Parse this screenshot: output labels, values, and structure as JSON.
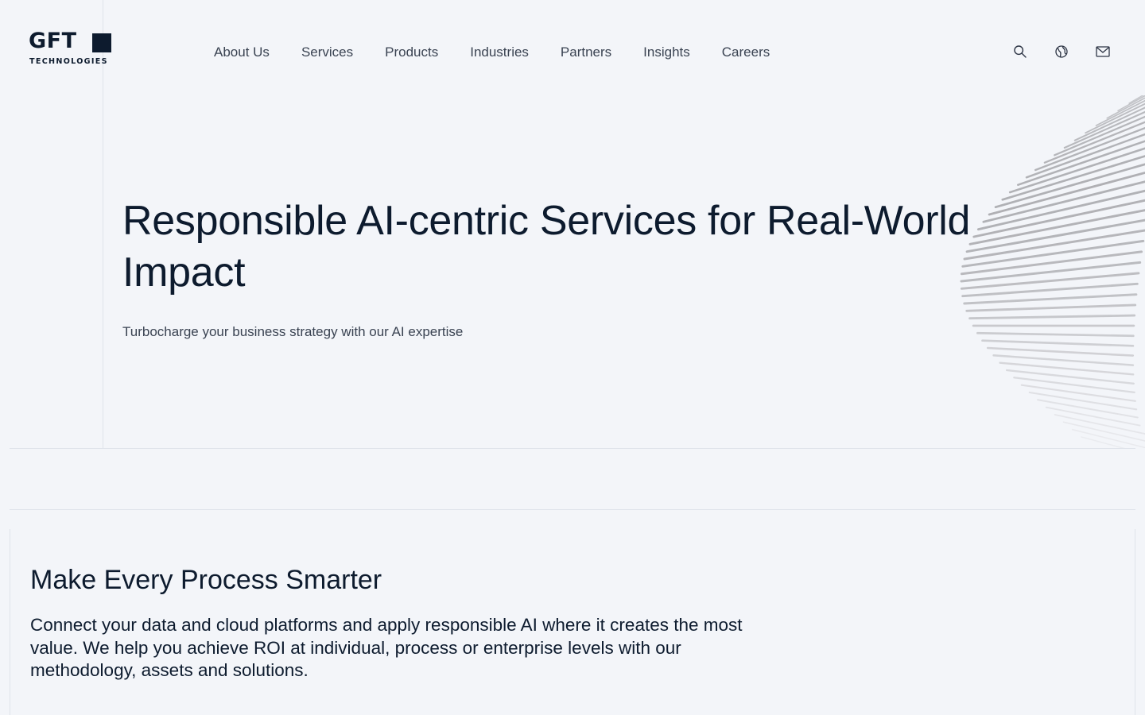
{
  "logo": {
    "wordmark": "GFT",
    "subline": "TECHNOLOGIES"
  },
  "nav": {
    "items": [
      {
        "label": "About Us"
      },
      {
        "label": "Services"
      },
      {
        "label": "Products"
      },
      {
        "label": "Industries"
      },
      {
        "label": "Partners"
      },
      {
        "label": "Insights"
      },
      {
        "label": "Careers"
      }
    ]
  },
  "utility_icons": [
    "search-icon",
    "globe-icon",
    "mail-icon"
  ],
  "hero": {
    "title": "Responsible AI-centric Services for Real-World Impact",
    "subtitle": "Turbocharge your business strategy with our AI expertise"
  },
  "section": {
    "title": "Make Every Process Smarter",
    "text": "Connect your data and cloud platforms and apply responsible AI where it creates the most value. We help you achieve ROI at individual, process or enterprise levels with our methodology, assets and solutions."
  },
  "colors": {
    "background": "#f3f5f9",
    "text_primary": "#0d1b2e",
    "text_secondary": "#3a4352",
    "divider": "#dfe3ea"
  }
}
